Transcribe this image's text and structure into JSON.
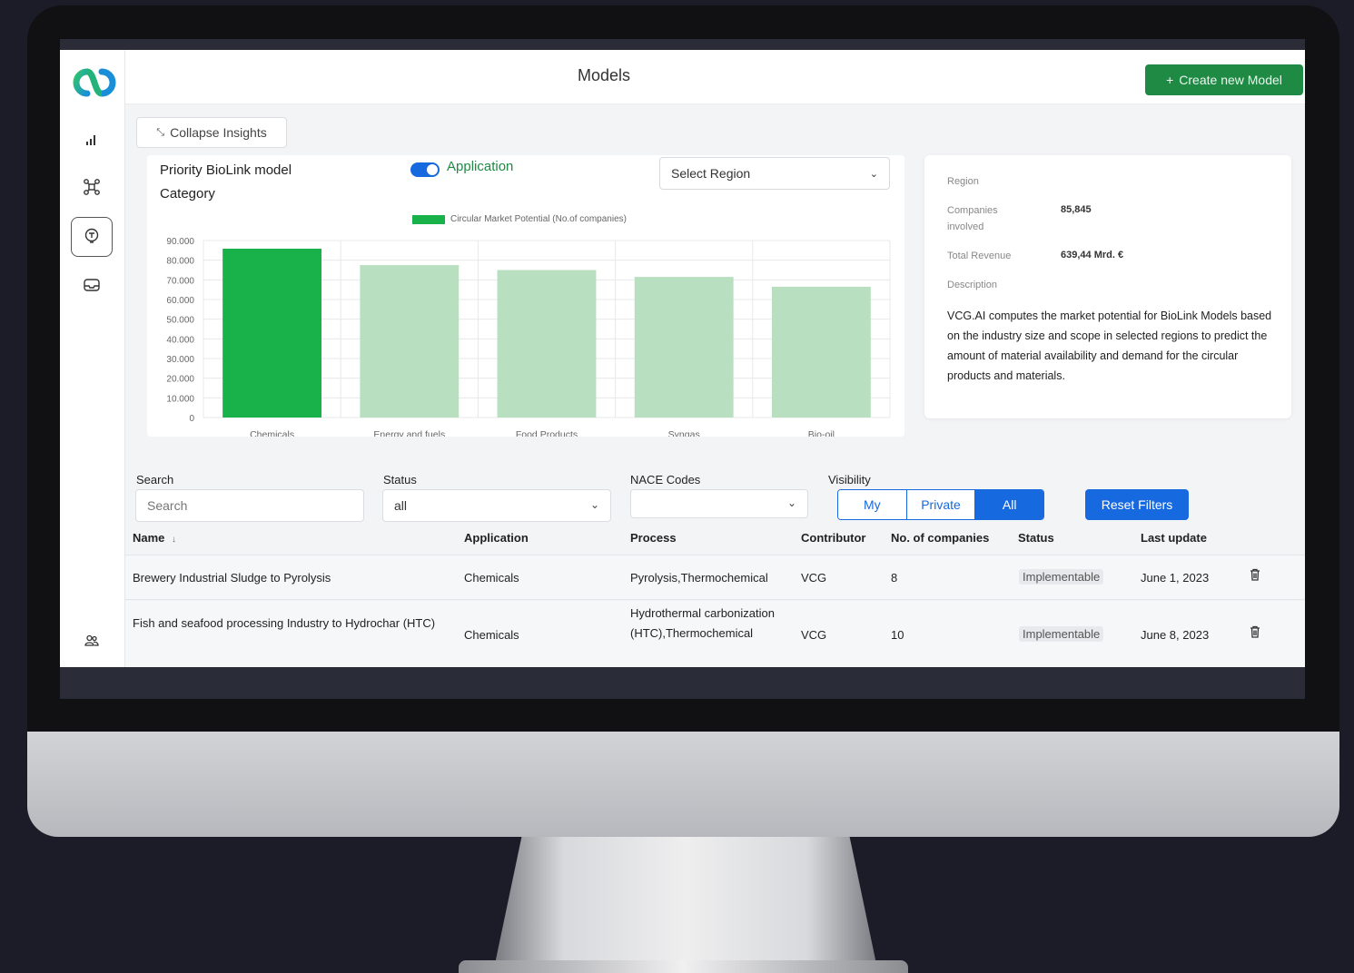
{
  "header": {
    "title": "Models",
    "create_label": "Create new Model",
    "plus_icon": "+"
  },
  "sidebar": {
    "items": [
      {
        "name": "bar-chart-icon"
      },
      {
        "name": "network-icon"
      },
      {
        "name": "lightbulb-icon"
      },
      {
        "name": "inbox-icon"
      },
      {
        "name": "users-icon"
      }
    ]
  },
  "insights": {
    "collapse_label": "Collapse Insights",
    "collapse_icon": "⤡"
  },
  "chart_card": {
    "title": "Priority BioLink model Category",
    "toggle_label": "Application",
    "region_placeholder": "Select Region"
  },
  "chart_data": {
    "type": "bar",
    "categories": [
      "Chemicals",
      "Energy and fuels",
      "Food Products",
      "Syngas",
      "Bio-oil"
    ],
    "series": [
      {
        "name": "Circular Market Potential (No.of companies)",
        "values": [
          85845,
          77500,
          75000,
          71500,
          66500
        ]
      }
    ],
    "ylim": [
      0,
      90000
    ],
    "yticks": [
      "0",
      "10.000",
      "20.000",
      "30.000",
      "40.000",
      "50.000",
      "60.000",
      "70.000",
      "80.000",
      "90.000"
    ],
    "highlight_index": 0,
    "colors": {
      "highlight": "#18b14a",
      "normal": "#b9dfc1"
    },
    "legend": "top",
    "grid": true
  },
  "info": {
    "region_label": "Region",
    "companies_label": "Companies involved",
    "companies_value": "85,845",
    "revenue_label": "Total Revenue",
    "revenue_value": "639,44 Mrd. €",
    "description_label": "Description",
    "description": "VCG.AI computes the market potential for BioLink Models based on the industry size and scope in selected regions to predict the amount of material availability and demand for the circular products and materials."
  },
  "filters": {
    "search_label": "Search",
    "search_placeholder": "Search",
    "status_label": "Status",
    "status_value": "all",
    "nace_label": "NACE Codes",
    "visibility_label": "Visibility",
    "visibility_options": [
      "My",
      "Private",
      "All"
    ],
    "visibility_selected": "All",
    "reset_label": "Reset Filters"
  },
  "table": {
    "columns": [
      "Name",
      "Application",
      "Process",
      "Contributor",
      "No. of companies",
      "Status",
      "Last update"
    ],
    "sort_icon": "↓",
    "rows": [
      {
        "name": "Brewery Industrial Sludge to Pyrolysis",
        "application": "Chemicals",
        "process": "Pyrolysis,Thermochemical",
        "contributor": "VCG",
        "companies": "8",
        "status": "Implementable",
        "updated": "June 1, 2023"
      },
      {
        "name": "Fish and seafood processing Industry to Hydrochar (HTC)",
        "application": "Chemicals",
        "process": "Hydrothermal carbonization (HTC),Thermochemical",
        "contributor": "VCG",
        "companies": "10",
        "status": "Implementable",
        "updated": "June 8, 2023"
      }
    ]
  },
  "colors": {
    "accent_green": "#1e8a44",
    "accent_blue": "#1769e0",
    "page_bg": "#1b1c27"
  }
}
